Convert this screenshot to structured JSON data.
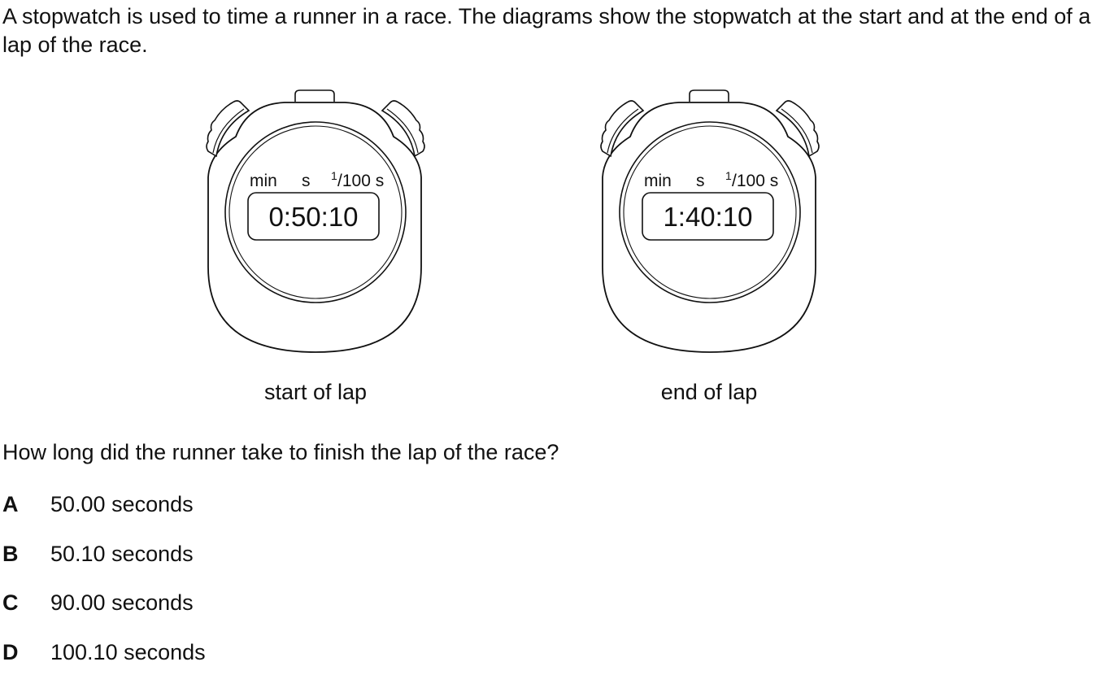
{
  "question": {
    "intro": "A stopwatch is used to time a runner in a race. The diagrams show the stopwatch at the start and at the end of a lap of the race.",
    "prompt": "How long did the runner take to finish the lap of the race?"
  },
  "stopwatches": [
    {
      "caption": "start of lap",
      "unit_min": "min",
      "unit_s": "s",
      "unit_hundredths_num": "1",
      "unit_hundredths_rest": "/100 s",
      "display": "0:50:10"
    },
    {
      "caption": "end of lap",
      "unit_min": "min",
      "unit_s": "s",
      "unit_hundredths_num": "1",
      "unit_hundredths_rest": "/100 s",
      "display": "1:40:10"
    }
  ],
  "options": [
    {
      "letter": "A",
      "text": "50.00 seconds"
    },
    {
      "letter": "B",
      "text": "50.10 seconds"
    },
    {
      "letter": "C",
      "text": "90.00 seconds"
    },
    {
      "letter": "D",
      "text": "100.10 seconds"
    }
  ]
}
